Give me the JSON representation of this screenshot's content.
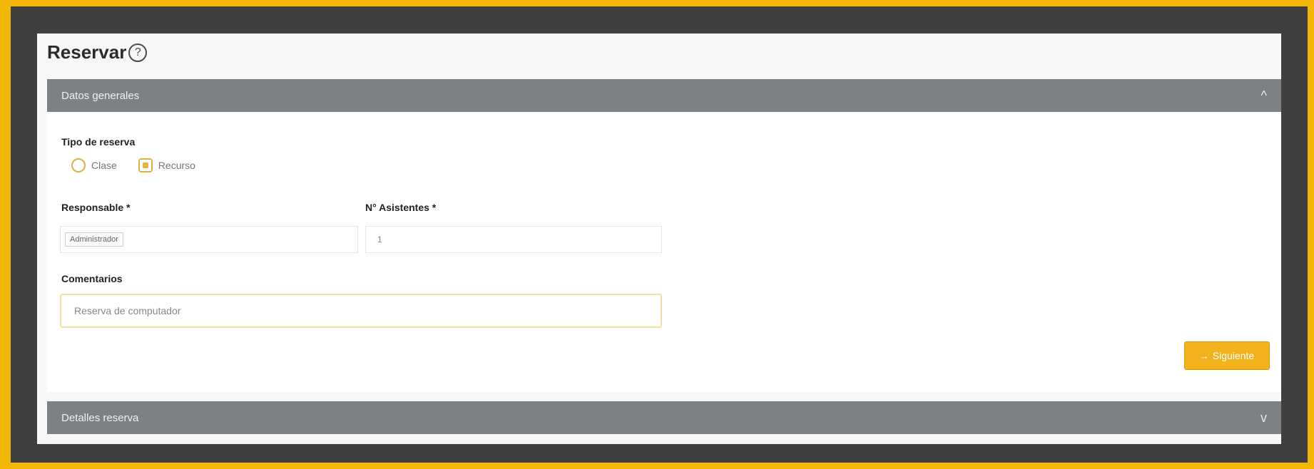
{
  "page": {
    "title": "Reservar",
    "help_icon": "?"
  },
  "sections": {
    "general": {
      "label": "Datos generales",
      "chevron": "^",
      "expanded": true
    },
    "details": {
      "label": "Detalles reserva",
      "chevron": "v",
      "expanded": false
    }
  },
  "form": {
    "booking_type": {
      "label": "Tipo de reserva",
      "options": [
        {
          "label": "Clase",
          "selected": false
        },
        {
          "label": "Recurso",
          "selected": true
        }
      ]
    },
    "responsible": {
      "label": "Responsable *",
      "value": "Administrador"
    },
    "attendees": {
      "label": "N° Asistentes *",
      "value": "1"
    },
    "comments": {
      "label": "Comentarios",
      "value": "Reserva de computador"
    }
  },
  "actions": {
    "next": {
      "label": "Siguiente",
      "icon": "→"
    }
  },
  "colors": {
    "frame": "#f2b705",
    "header": "#7e8183",
    "accent": "#f2b21c"
  }
}
